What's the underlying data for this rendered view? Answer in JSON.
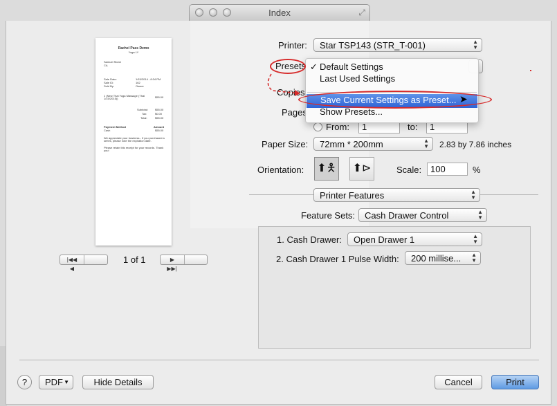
{
  "window": {
    "title": "Index"
  },
  "preview": {
    "page_indicator": "1 of 1",
    "receipt": {
      "title": "Rachel Pass Demo",
      "subtitle": "Yoga LY",
      "address": [
        "Samuel Stone",
        "CA"
      ],
      "sale_info": [
        [
          "Sale Date:",
          "1/15/2014 - 8:34 PM"
        ],
        [
          "Sale ID:",
          "162"
        ],
        [
          "Sold By:",
          "Owner"
        ]
      ],
      "line_item": "1 (New Thai Yoga Massage (Thai 1/15/2015))",
      "line_amount": "$55.00",
      "totals": [
        [
          "Subtotal:",
          "$55.00"
        ],
        [
          "Tax:",
          "$0.00"
        ],
        [
          "Total:",
          "$55.00"
        ]
      ],
      "payment_header": "Payment Method",
      "payment_amount_header": "Amount",
      "payment_row": [
        "Cash",
        "$55.00"
      ],
      "notes": [
        "We appreciate your business - if you purchased a series, please note the expiration date.",
        "Please retain this receipt for your records. Thank you!"
      ]
    }
  },
  "printer": {
    "label": "Printer:",
    "value": "Star TSP143 (STR_T-001)"
  },
  "presets": {
    "label": "Presets",
    "menu": {
      "default": "Default Settings",
      "last_used": "Last Used Settings",
      "save_current": "Save Current Settings as Preset...",
      "show": "Show Presets...",
      "check": "✓"
    }
  },
  "copies": {
    "label": "Copies"
  },
  "pages": {
    "label": "Pages",
    "from_label": "From:",
    "from_value": "1",
    "to_label": "to:",
    "to_value": "1"
  },
  "paper_size": {
    "label": "Paper Size:",
    "value": "72mm * 200mm",
    "dimensions": "2.83 by 7.86 inches"
  },
  "orientation": {
    "label": "Orientation:"
  },
  "scale": {
    "label": "Scale:",
    "value": "100",
    "unit": "%"
  },
  "section_popup": {
    "value": "Printer Features"
  },
  "feature_sets": {
    "label": "Feature Sets:",
    "value": "Cash Drawer Control"
  },
  "cash_drawer": {
    "label": "1. Cash Drawer:",
    "value": "Open Drawer 1"
  },
  "pulse_width": {
    "label": "2. Cash Drawer 1 Pulse Width:",
    "value": "200 millise..."
  },
  "footer": {
    "help": "?",
    "pdf": "PDF",
    "hide_details": "Hide Details",
    "cancel": "Cancel",
    "print": "Print"
  },
  "colors": {
    "annotation": "#d62b2b",
    "highlight": "#2d62d6",
    "print_button": "#5e9ae3"
  }
}
